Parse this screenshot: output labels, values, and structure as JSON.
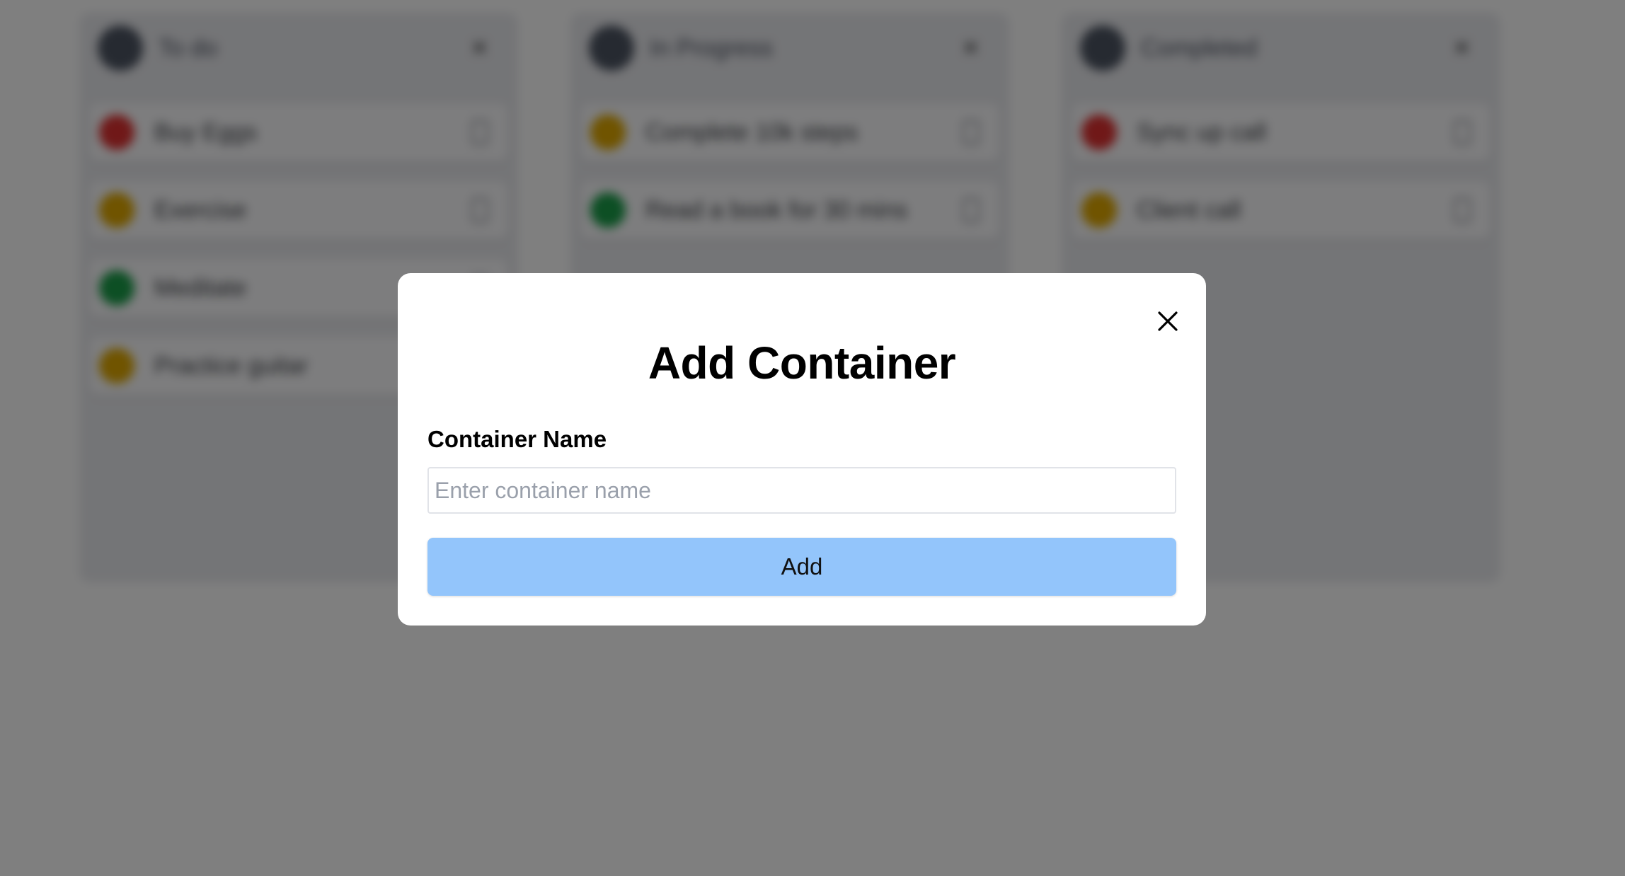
{
  "board": {
    "columns": [
      {
        "title": "To do",
        "cards": [
          {
            "text": "Buy Eggs",
            "color": "#e03131"
          },
          {
            "text": "Exercise",
            "color": "#e0a800"
          },
          {
            "text": "Meditate",
            "color": "#1a9e49"
          },
          {
            "text": "Practice guitar",
            "color": "#e0a800"
          }
        ]
      },
      {
        "title": "In Progress",
        "cards": [
          {
            "text": "Complete 10k steps",
            "color": "#e0a800"
          },
          {
            "text": "Read a book for 30 mins",
            "color": "#1a9e49"
          }
        ]
      },
      {
        "title": "Completed",
        "cards": [
          {
            "text": "Sync up call",
            "color": "#e03131"
          },
          {
            "text": "Client call",
            "color": "#e0a800"
          }
        ]
      }
    ]
  },
  "modal": {
    "title": "Add Container",
    "field_label": "Container Name",
    "input_value": "",
    "input_placeholder": "Enter container name",
    "add_label": "Add",
    "close_icon": "close-icon"
  },
  "colors": {
    "overlay": "rgba(0,0,0,0.5)",
    "add_button": "#93c5fb",
    "modal_background": "#ffffff"
  }
}
